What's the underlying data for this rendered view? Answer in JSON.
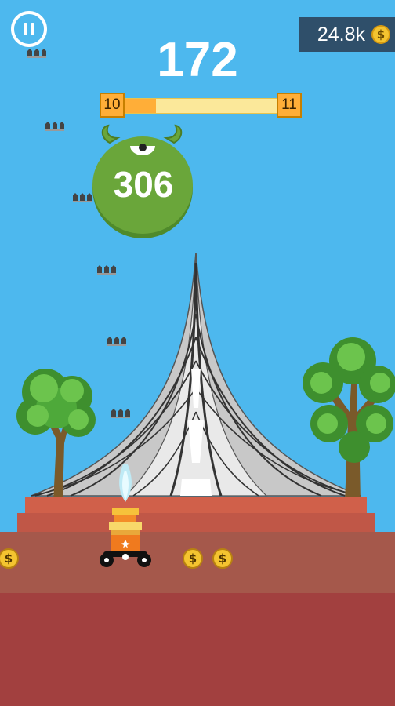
{
  "hud": {
    "coins": "24.8k",
    "coin_symbol": "$",
    "score": "172",
    "level_current": "10",
    "level_next": "11",
    "level_progress": 0.21
  },
  "monster": {
    "hp": "306",
    "color": "#6aa63a"
  },
  "ground": {
    "coin_symbol": "$"
  },
  "colors": {
    "sky": "#4db8ee",
    "ground_top": "#a5584b",
    "ground_bottom": "#a2403f",
    "hud_panel": "#2f4f6a",
    "progress_fill": "#ffae38",
    "progress_track": "#fbe89a"
  }
}
